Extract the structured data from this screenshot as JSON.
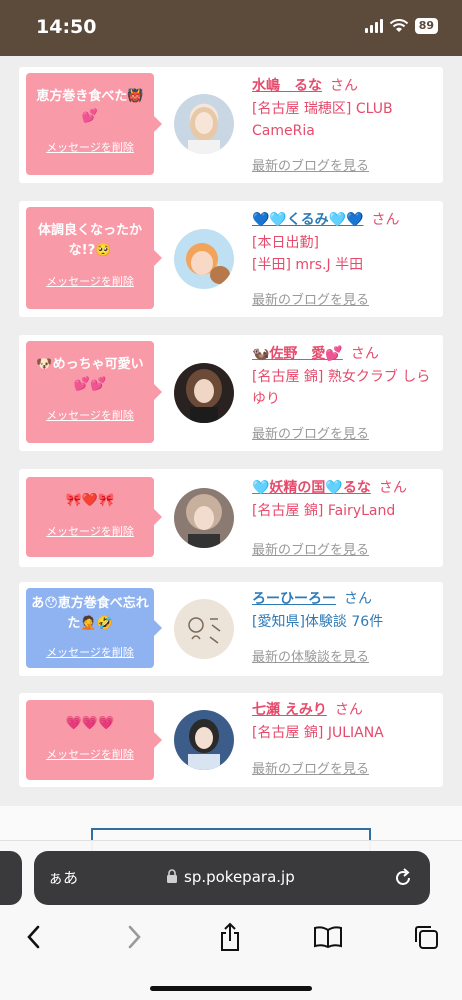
{
  "status_bar": {
    "time": "14:50",
    "battery": "89"
  },
  "messages": [
    {
      "bubble_text": "恵方巻き食べた👹💕",
      "bubble_color": "pink",
      "delete_label": "メッセージを削除",
      "name": "水嶋　るな",
      "honorific": "さん",
      "shop": "[名古屋 瑞穂区] CLUB CameRia",
      "link": "最新のブログを見る"
    },
    {
      "bubble_text": "体調良くなったかな!?🥺",
      "bubble_color": "pink",
      "delete_label": "メッセージを削除",
      "name": "💙🩵くるみ🩵💙",
      "honorific": "さん",
      "shop": "[本日出勤]\n[半田] mrs.J 半田",
      "link": "最新のブログを見る"
    },
    {
      "bubble_text": "🐶めっちゃ可愛い💕💕",
      "bubble_color": "pink",
      "delete_label": "メッセージを削除",
      "name": "🦦佐野　愛💕",
      "honorific": "さん",
      "shop": "[名古屋 錦] 熟女クラブ しらゆり",
      "link": "最新のブログを見る"
    },
    {
      "bubble_text": "🎀❤️🎀",
      "bubble_color": "pink",
      "delete_label": "メッセージを削除",
      "name": "🩵妖精の国🩵るな",
      "honorific": "さん",
      "shop": "[名古屋 錦] FairyLand",
      "link": "最新のブログを見る"
    },
    {
      "bubble_text": "あ😯恵方巻食べ忘れた🤦🤣",
      "bubble_color": "blue",
      "delete_label": "メッセージを削除",
      "name": "ろーひーろー",
      "honorific": "さん",
      "shop": "[愛知県]体験談 76件",
      "link": "最新の体験談を見る"
    },
    {
      "bubble_text": "💗💗💗",
      "bubble_color": "pink",
      "delete_label": "メッセージを削除",
      "name": "七瀬 えみり",
      "honorific": "さん",
      "shop": "[名古屋 錦] JULIANA",
      "link": "最新のブログを見る"
    }
  ],
  "browser": {
    "aa_label": "ぁあ",
    "url": "sp.pokepara.jp",
    "icons": [
      "lock-icon",
      "reload-icon",
      "back-icon",
      "forward-icon",
      "share-icon",
      "bookmarks-icon",
      "tabs-icon"
    ]
  },
  "colors": {
    "accent_pink": "#e64b6c",
    "accent_blue": "#2f7bb8",
    "bubble_pink": "#f99aa8",
    "bubble_blue": "#8fb2f0",
    "status_bar": "#5c4a3a"
  }
}
